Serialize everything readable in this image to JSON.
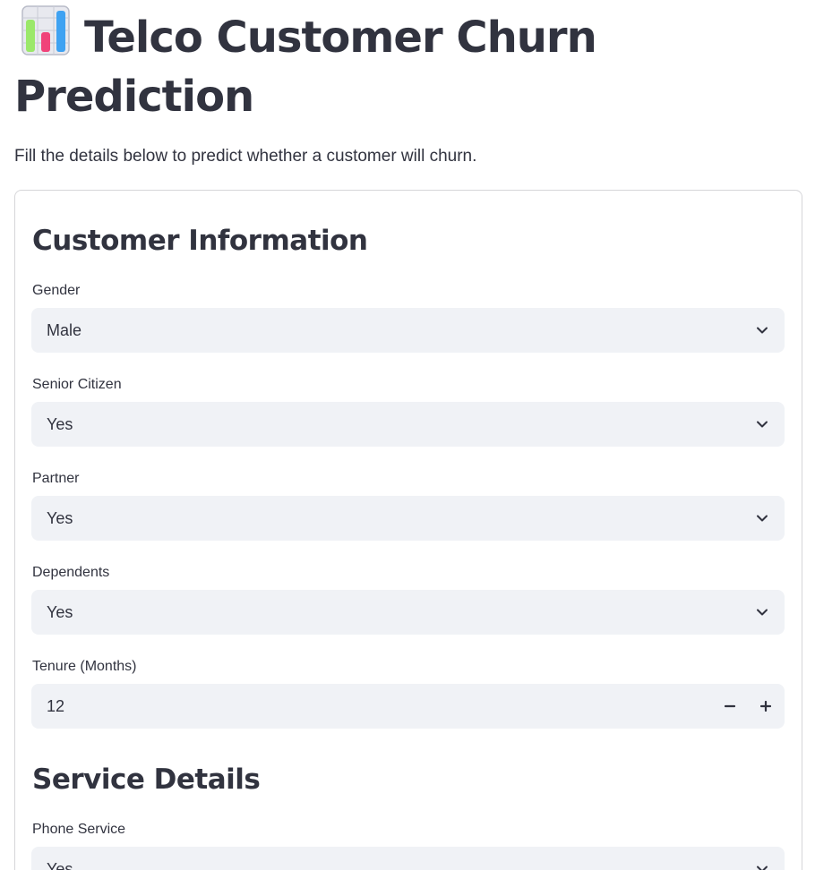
{
  "header": {
    "emoji_icon": "bar-chart-emoji",
    "title": "Telco Customer Churn Prediction",
    "subtitle": "Fill the details below to predict whether a customer will churn."
  },
  "sections": {
    "customer_info": {
      "heading": "Customer Information",
      "gender": {
        "label": "Gender",
        "value": "Male"
      },
      "senior_citizen": {
        "label": "Senior Citizen",
        "value": "Yes"
      },
      "partner": {
        "label": "Partner",
        "value": "Yes"
      },
      "dependents": {
        "label": "Dependents",
        "value": "Yes"
      },
      "tenure": {
        "label": "Tenure (Months)",
        "value": "12"
      }
    },
    "service_details": {
      "heading": "Service Details",
      "phone_service": {
        "label": "Phone Service",
        "value": "Yes"
      }
    }
  },
  "colors": {
    "text": "#31333f",
    "input_bg": "#f0f2f6",
    "border": "#d6d6d9"
  }
}
